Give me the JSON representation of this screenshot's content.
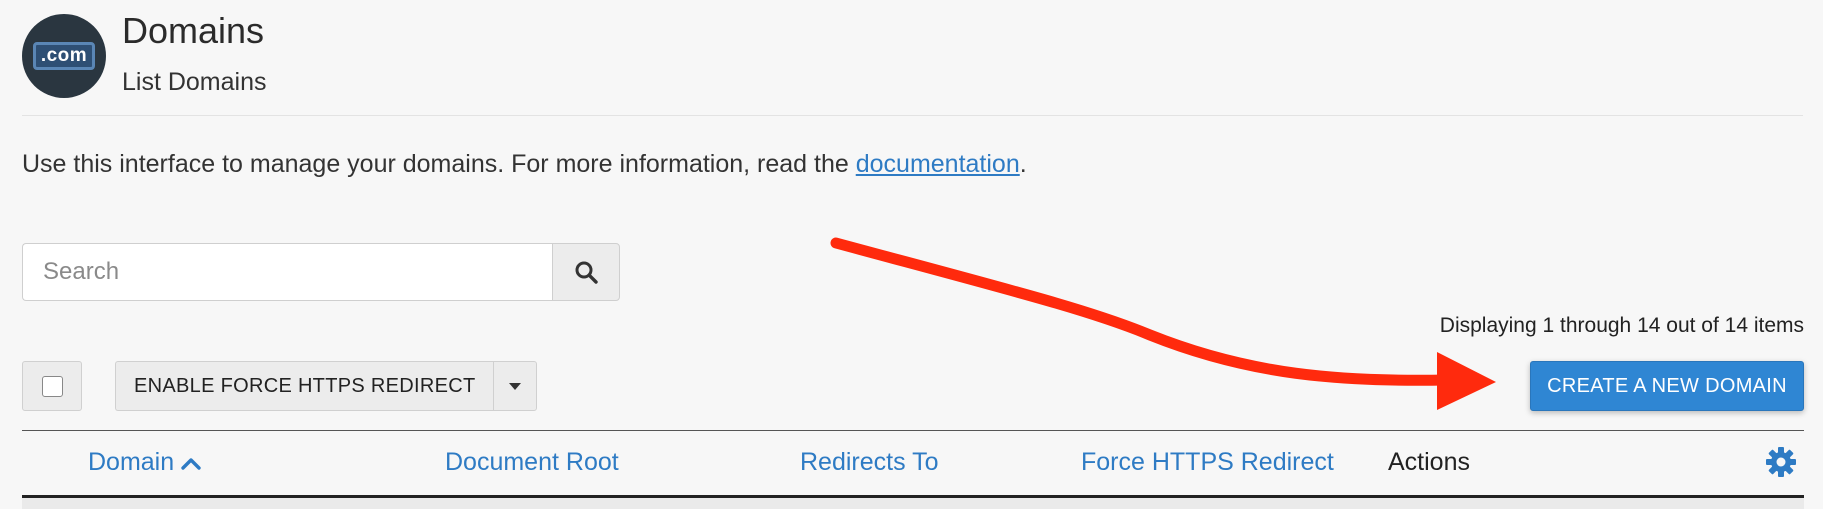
{
  "header": {
    "title": "Domains",
    "subtitle": "List Domains",
    "logo_text": ".com"
  },
  "description": {
    "text": "Use this interface to manage your domains. For more information, read the ",
    "link_text": "documentation",
    "suffix": "."
  },
  "search": {
    "placeholder": "Search",
    "value": "",
    "icon": "search-icon"
  },
  "pagination": {
    "display_text": "Displaying 1 through 14 out of 14 items"
  },
  "toolbar": {
    "select_all_checked": false,
    "bulk_action_label": "ENABLE FORCE HTTPS REDIRECT",
    "create_label": "CREATE A NEW DOMAIN"
  },
  "table": {
    "columns": [
      {
        "label": "Domain",
        "sortable": true,
        "sorted": "asc"
      },
      {
        "label": "Document Root",
        "sortable": true
      },
      {
        "label": "Redirects To",
        "sortable": true
      },
      {
        "label": "Force HTTPS Redirect",
        "sortable": true
      },
      {
        "label": "Actions",
        "sortable": false
      }
    ],
    "settings_icon": "gear-icon"
  },
  "colors": {
    "accent": "#2f86d3",
    "link": "#2e7bc4",
    "annotation_arrow": "#ff2a0d",
    "logo_bg": "#2a3640"
  }
}
